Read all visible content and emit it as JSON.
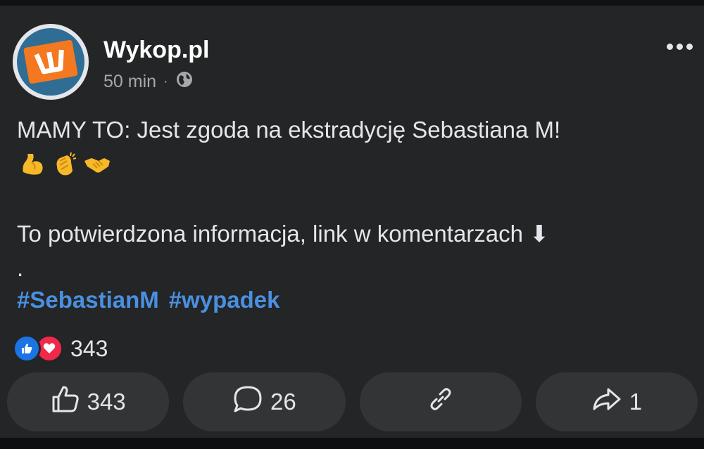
{
  "post": {
    "author": "Wykop.pl",
    "time": "50 min",
    "separator": "·",
    "privacy_icon": "globe-icon",
    "line1": "MAMY TO: Jest zgoda na ekstradycję Sebastiana M!",
    "emojis": [
      "flexed-biceps-icon",
      "clapping-hands-icon",
      "handshake-icon"
    ],
    "line2": "To potwierdzona informacja, link w komentarzach ⬇",
    "line3": ".",
    "hashtags": [
      "#SebastianM",
      "#wypadek"
    ]
  },
  "reactions": {
    "icons": [
      "like-icon",
      "love-icon"
    ],
    "count": "343"
  },
  "actions": {
    "like_count": "343",
    "comment_count": "26",
    "share_count": "1"
  },
  "colors": {
    "background": "#242526",
    "hashtag": "#4a90e2",
    "like": "#1b74e4",
    "love": "#f0284a",
    "avatar_tile": "#f3781f",
    "avatar_ring": "#2f6d95"
  }
}
